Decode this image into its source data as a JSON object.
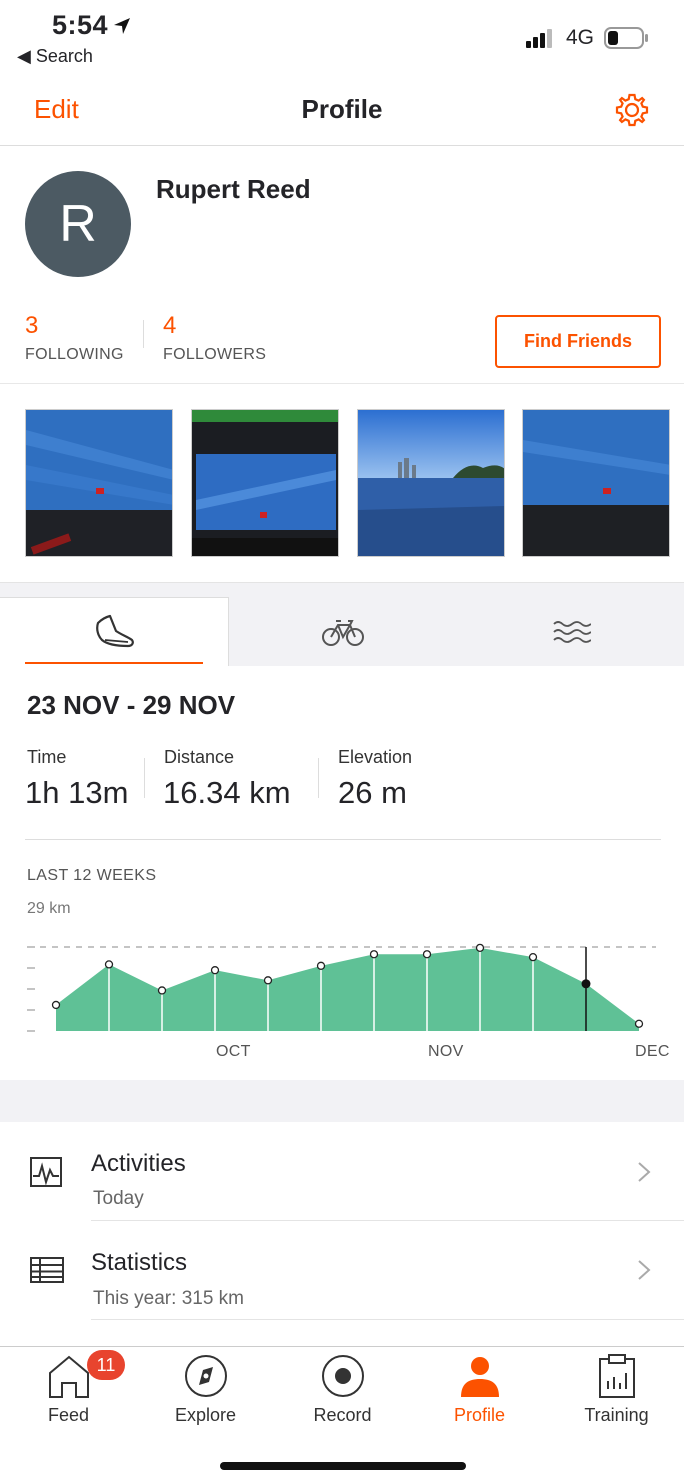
{
  "status_bar": {
    "time": "5:54",
    "back_label": "Search",
    "network": "4G"
  },
  "nav": {
    "edit_label": "Edit",
    "title": "Profile",
    "settings_icon": "gear-icon"
  },
  "profile": {
    "avatar_letter": "R",
    "name": "Rupert Reed",
    "following_count": "3",
    "following_label": "FOLLOWING",
    "followers_count": "4",
    "followers_label": "FOLLOWERS",
    "find_friends_label": "Find Friends"
  },
  "photos": [
    "treadmill-summary-screen-1",
    "lifefitness-console-screen",
    "lake-and-city-skyline",
    "treadmill-summary-screen-2"
  ],
  "sport_tabs": [
    {
      "icon": "running-shoe-icon",
      "active": true
    },
    {
      "icon": "bicycle-icon",
      "active": false
    },
    {
      "icon": "swim-waves-icon",
      "active": false
    }
  ],
  "week": {
    "range": "23 NOV - 29 NOV",
    "time_label": "Time",
    "time_value": "1h 13m",
    "distance_label": "Distance",
    "distance_value": "16.34 km",
    "elevation_label": "Elevation",
    "elevation_value": "26 m"
  },
  "chart_data": {
    "type": "area",
    "title": "LAST 12 WEEKS",
    "ymax_label": "29 km",
    "ylim": [
      0,
      29
    ],
    "x": [
      1,
      2,
      3,
      4,
      5,
      6,
      7,
      8,
      9,
      10,
      11,
      12
    ],
    "values": [
      9,
      23,
      14,
      21,
      17.5,
      22.5,
      26.5,
      26.5,
      28.7,
      25.5,
      16.3,
      2.5
    ],
    "selected_index": 10,
    "month_labels": [
      "OCT",
      "NOV",
      "DEC"
    ],
    "color": "#5fc196",
    "grid": false
  },
  "list": {
    "activities_title": "Activities",
    "activities_sub": "Today",
    "statistics_title": "Statistics",
    "statistics_sub": "This year: 315 km"
  },
  "tabbar": {
    "items": [
      {
        "label": "Feed",
        "icon": "home-icon"
      },
      {
        "label": "Explore",
        "icon": "compass-icon"
      },
      {
        "label": "Record",
        "icon": "record-icon"
      },
      {
        "label": "Profile",
        "icon": "person-icon"
      },
      {
        "label": "Training",
        "icon": "clipboard-chart-icon"
      }
    ],
    "feed_badge": "11"
  },
  "colors": {
    "accent": "#fc5200",
    "chart_fill": "#5fc196",
    "avatar": "#4c5a63",
    "badge": "#e8442e"
  }
}
